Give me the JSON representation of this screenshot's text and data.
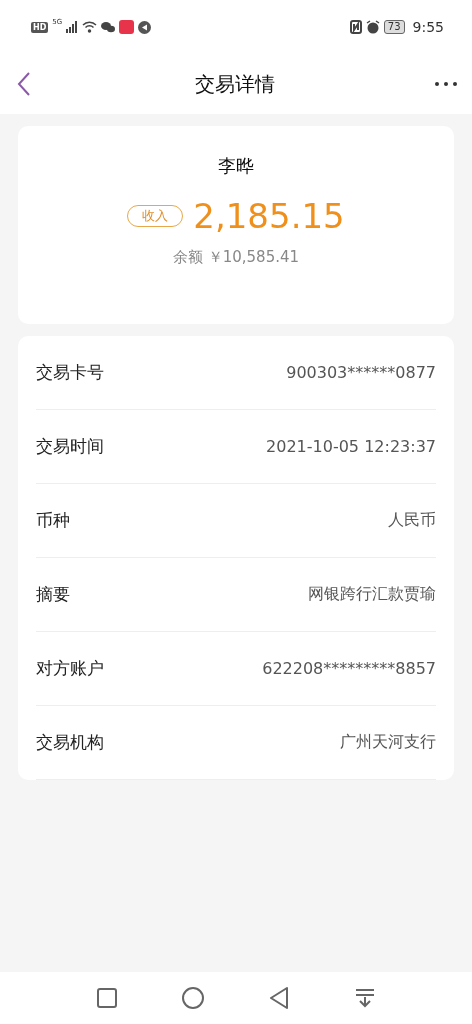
{
  "status_bar": {
    "hd": "HD",
    "network": "5G",
    "battery": "73",
    "time": "9:55"
  },
  "header": {
    "title": "交易详情"
  },
  "summary": {
    "name": "李晔",
    "tag": "收入",
    "amount": "2,185.15",
    "balance_label": "余额",
    "balance": "￥10,585.41"
  },
  "details": [
    {
      "label": "交易卡号",
      "value": "900303******0877"
    },
    {
      "label": "交易时间",
      "value": "2021-10-05 12:23:37"
    },
    {
      "label": "币种",
      "value": "人民币"
    },
    {
      "label": "摘要",
      "value": "网银跨行汇款贾瑜"
    },
    {
      "label": "对方账户",
      "value": "622208*********8857"
    },
    {
      "label": "交易机构",
      "value": "广州天河支行"
    }
  ]
}
